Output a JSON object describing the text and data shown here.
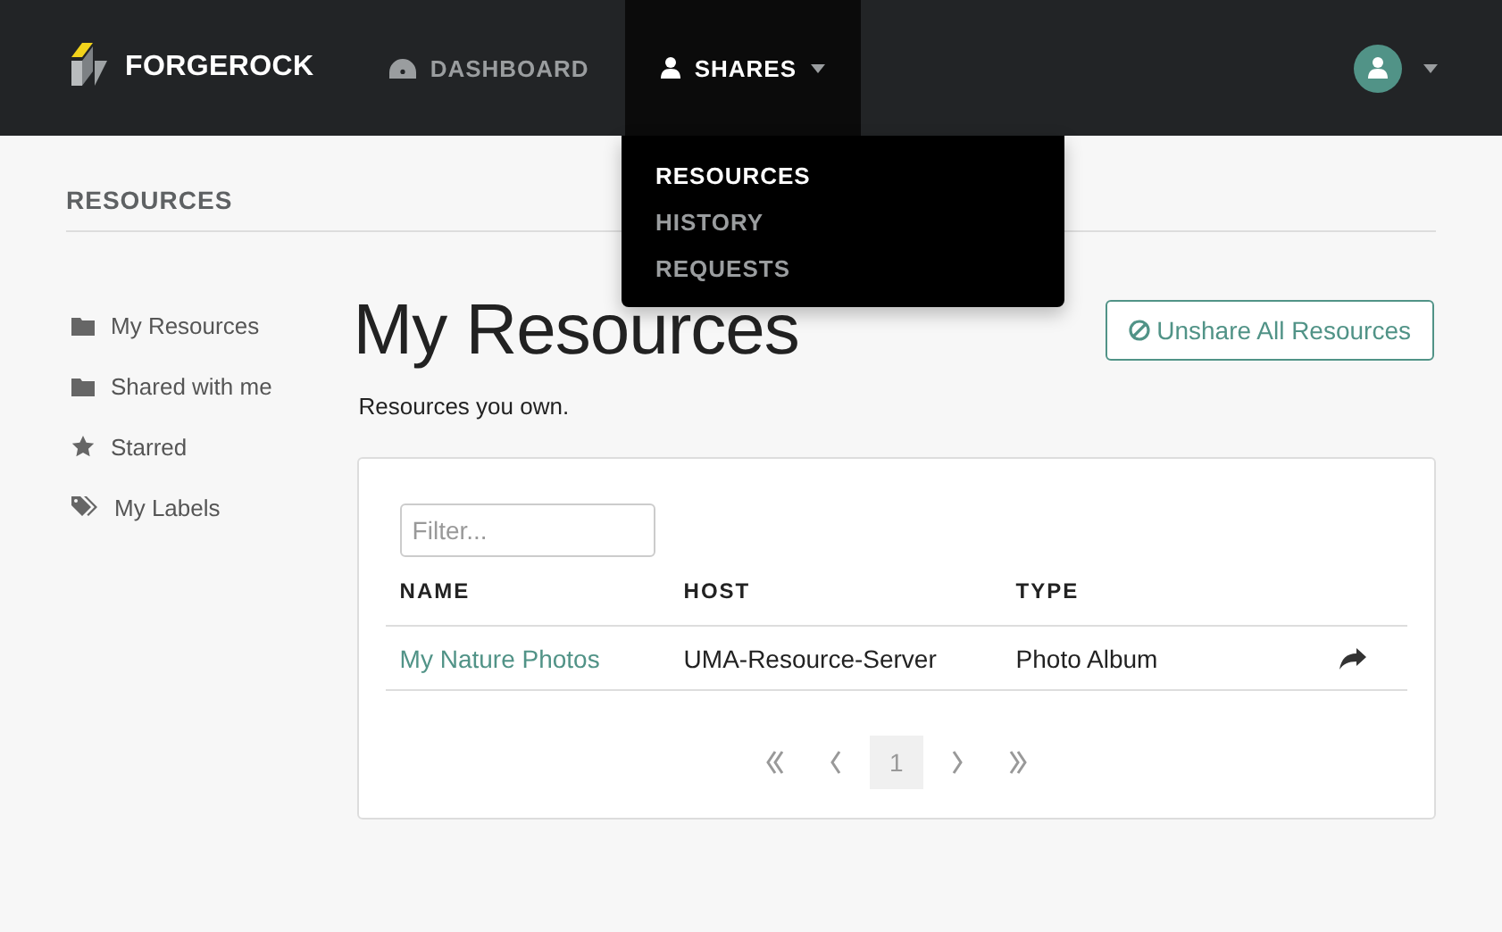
{
  "navbar": {
    "brand": "FORGEROCK",
    "items": [
      {
        "label": "DASHBOARD",
        "kind": "dashboard",
        "selected": false
      },
      {
        "label": "SHARES",
        "kind": "user",
        "selected": true,
        "expanded": true
      }
    ]
  },
  "dropdown": [
    {
      "label": "RESOURCES",
      "selected": true
    },
    {
      "label": "HISTORY",
      "selected": false
    },
    {
      "label": "REQUESTS",
      "selected": false
    }
  ],
  "section_title": "RESOURCES",
  "sidebar": [
    {
      "label": "My Resources",
      "kind": "folder"
    },
    {
      "label": "Shared with me",
      "kind": "folder"
    },
    {
      "label": "Starred",
      "kind": "star"
    },
    {
      "label": "My Labels",
      "kind": "tags"
    }
  ],
  "page": {
    "title": "My Resources",
    "subtitle": "Resources you own.",
    "action": "Unshare All Resources"
  },
  "table": {
    "filter": {
      "placeholder": "Filter..."
    },
    "columns": [
      "NAME",
      "HOST",
      "TYPE"
    ],
    "rows": [
      {
        "name": "My Nature Photos",
        "host": "UMA-Resource-Server",
        "type": "Photo Album"
      }
    ]
  },
  "pagination": {
    "pages": [
      {
        "label": "1",
        "selected": true
      }
    ]
  }
}
